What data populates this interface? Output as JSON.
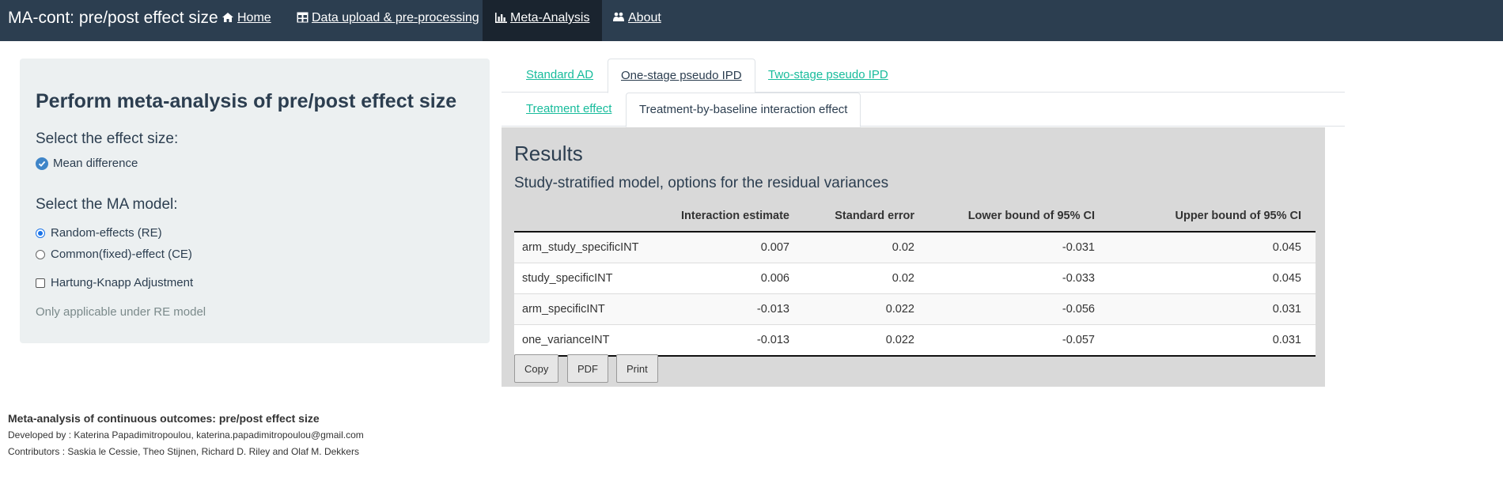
{
  "nav": {
    "brand": "MA-cont: pre/post effect size",
    "items": [
      {
        "label": "Home",
        "icon": "home-icon"
      },
      {
        "label": "Data upload & pre-processing",
        "icon": "table-icon"
      },
      {
        "label": "Meta-Analysis",
        "icon": "bar-chart-icon",
        "active": true
      },
      {
        "label": "About",
        "icon": "people-icon"
      }
    ]
  },
  "sidebar": {
    "title": "Perform meta-analysis of pre/post effect size",
    "effect_size_label": "Select the effect size:",
    "effect_size_option": "Mean difference",
    "model_label": "Select the MA model:",
    "model_options": [
      "Random-effects (RE)",
      "Common(fixed)-effect (CE)"
    ],
    "model_selected": "Random-effects (RE)",
    "hk_label": "Hartung-Knapp Adjustment",
    "hk_checked": false,
    "help_text": "Only applicable under RE model"
  },
  "tabs": {
    "level1": [
      "Standard AD",
      "One-stage pseudo IPD",
      "Two-stage pseudo IPD"
    ],
    "level1_active": "One-stage pseudo IPD",
    "level2": [
      "Treatment effect",
      "Treatment-by-baseline interaction effect"
    ],
    "level2_active": "Treatment-by-baseline interaction effect"
  },
  "results": {
    "title": "Results",
    "subtitle": "Study-stratified model, options for the residual variances",
    "columns": [
      "",
      "Interaction estimate",
      "Standard error",
      "Lower bound of 95% CI",
      "Upper bound of 95% CI"
    ],
    "rows": [
      [
        "arm_study_specificINT",
        "0.007",
        "0.02",
        "-0.031",
        "0.045"
      ],
      [
        "study_specificINT",
        "0.006",
        "0.02",
        "-0.033",
        "0.045"
      ],
      [
        "arm_specificINT",
        "-0.013",
        "0.022",
        "-0.056",
        "0.031"
      ],
      [
        "one_varianceINT",
        "-0.013",
        "0.022",
        "-0.057",
        "0.031"
      ]
    ],
    "buttons": [
      "Copy",
      "PDF",
      "Print"
    ]
  },
  "footer": {
    "title": "Meta-analysis of continuous outcomes: pre/post effect size",
    "developed_by": "Developed by : Katerina Papadimitropoulou, katerina.papadimitropoulou@gmail.com",
    "contributors": "Contributors : Saskia le Cessie, Theo Stijnen, Richard D. Riley and Olaf M. Dekkers"
  },
  "colors": {
    "navbar": "#2c3e50",
    "navbar_active": "#1a242f",
    "link": "#18bc9c",
    "sidebar_bg": "#ecf0f1",
    "results_bg": "#d9d9d9"
  }
}
